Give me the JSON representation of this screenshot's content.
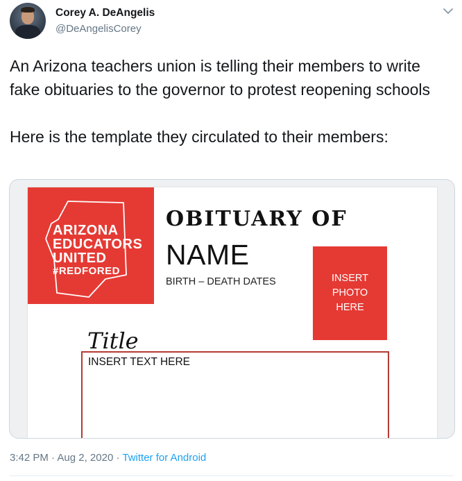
{
  "author": {
    "name": "Corey A. DeAngelis",
    "handle": "@DeAngelisCorey"
  },
  "tweet": {
    "text": "An Arizona teachers union is telling their members to write fake obituaries to the governor to protest reopening schools\n\nHere is the template they circulated to their members:"
  },
  "media": {
    "logo": {
      "line1": "ARIZONA",
      "line2": "EDUCATORS",
      "line3": "UNITED",
      "tag": "#REDFORED"
    },
    "obituary_heading": "OBITUARY OF",
    "name_placeholder": "NAME",
    "dates_placeholder": "BIRTH – DEATH DATES",
    "photo_placeholder": [
      "INSERT",
      "PHOTO",
      "HERE"
    ],
    "title_label": "Title",
    "text_placeholder": "INSERT TEXT HERE"
  },
  "meta": {
    "time": "3:42 PM",
    "date": "Aug 2, 2020",
    "app": "Twitter for Android"
  },
  "colors": {
    "brand_red": "#e53a34",
    "link_blue": "#1da1f2",
    "muted_gray": "#657786"
  }
}
